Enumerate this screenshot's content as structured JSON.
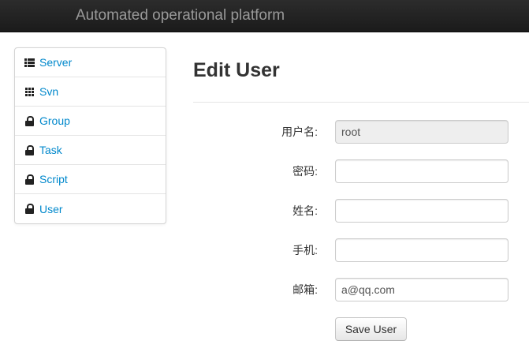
{
  "navbar": {
    "brand": "Automated operational platform"
  },
  "sidebar": {
    "items": [
      {
        "label": "Server",
        "icon": "list-icon"
      },
      {
        "label": "Svn",
        "icon": "grid-icon"
      },
      {
        "label": "Group",
        "icon": "lock-icon"
      },
      {
        "label": "Task",
        "icon": "lock-icon"
      },
      {
        "label": "Script",
        "icon": "lock-icon"
      },
      {
        "label": "User",
        "icon": "lock-icon"
      }
    ]
  },
  "main": {
    "title": "Edit User",
    "form": {
      "username_label": "用户名:",
      "username_value": "root",
      "password_label": "密码:",
      "password_value": "",
      "name_label": "姓名:",
      "name_value": "",
      "phone_label": "手机:",
      "phone_value": "",
      "email_label": "邮箱:",
      "email_value": "a@qq.com",
      "save_label": "Save User"
    }
  },
  "colors": {
    "link": "#0088cc",
    "navbar": "#1b1b1b"
  }
}
